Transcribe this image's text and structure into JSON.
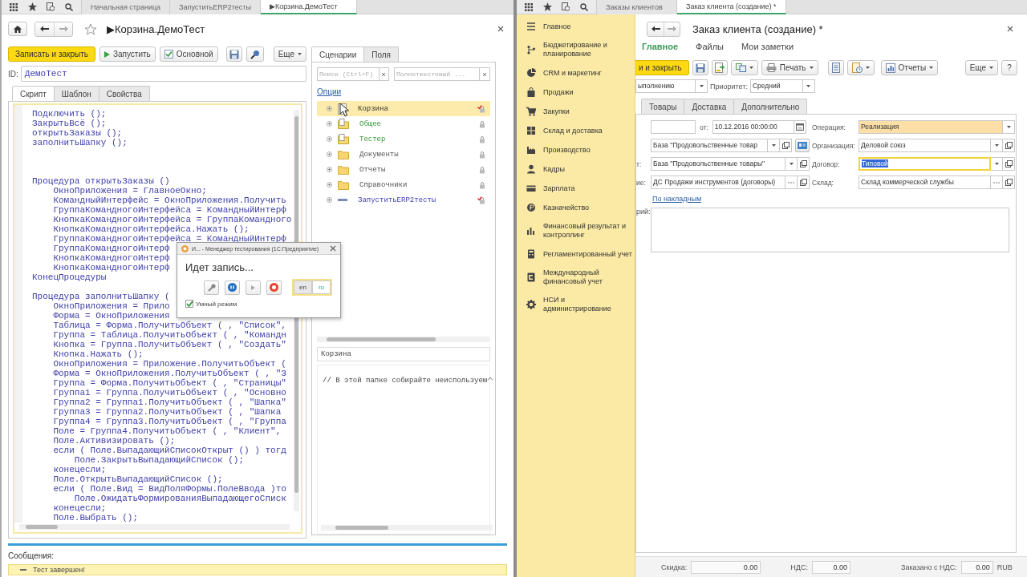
{
  "left_window": {
    "topbar": {
      "tabs": [
        {
          "label": "Начальная страница",
          "selected": false
        },
        {
          "label": "ЗапуститьERP2тесты",
          "selected": false
        },
        {
          "label": "▶Корзина.ДемоТест",
          "selected": true
        }
      ]
    },
    "title": "▶Корзина.ДемоТест",
    "toolbar": [
      {
        "kind": "primary",
        "label": "Записать и закрыть",
        "dropdown": false
      },
      {
        "kind": "run",
        "label": "Запустить",
        "dropdown": false
      },
      {
        "kind": "check",
        "label": "Основной",
        "dropdown": false
      },
      {
        "kind": "save",
        "dropdown": false
      },
      {
        "kind": "search",
        "dropdown": false
      }
    ],
    "toolbar_right": [
      {
        "kind": "more",
        "label": "Еще",
        "dropdown": true
      }
    ],
    "id_label": "ID:",
    "id_value": "ДемоТест",
    "editor_tabs": [
      {
        "label": "Скрипт",
        "selected": true
      },
      {
        "label": "Шаблон",
        "selected": false
      },
      {
        "label": "Свойства",
        "selected": false
      }
    ],
    "code": [
      {
        "kind": "code",
        "text": "Подключить ();"
      },
      {
        "kind": "code",
        "text": "ЗакрытьВсё ();"
      },
      {
        "kind": "code",
        "text": "открытьЗаказы ();"
      },
      {
        "kind": "code",
        "text": "заполнитьШапку ();"
      },
      {
        "kind": "blank"
      },
      {
        "kind": "blank"
      },
      {
        "kind": "blank"
      },
      {
        "kind": "code",
        "text": "Процедура открытьЗаказы ()"
      },
      {
        "kind": "code",
        "text": "    ОкноПриложения = ГлавноеОкно;"
      },
      {
        "kind": "code",
        "text": "    КомандныйИнтерфейс = ОкноПриложения.Получить"
      },
      {
        "kind": "code",
        "text": "    ГруппаКомандногоИнтерфейса = КомандныйИнтерф"
      },
      {
        "kind": "code",
        "text": "    КнопкаКомандногоИнтерфейса = ГруппаКомандного"
      },
      {
        "kind": "code",
        "text": "    КнопкаКомандногоИнтерфейса.Нажать ();"
      },
      {
        "kind": "code",
        "text": "    ГруппаКомандногоИнтерфейса = КомандныйИнтерф"
      },
      {
        "kind": "code",
        "text": "    ГруппаКомандногоИнтерф"
      },
      {
        "kind": "code",
        "text": "    КнопкаКомандногоИнтерф"
      },
      {
        "kind": "code",
        "text": "    КнопкаКомандногоИнтерф"
      },
      {
        "kind": "code",
        "text": "КонецПроцедуры"
      },
      {
        "kind": "blank"
      },
      {
        "kind": "code",
        "text": "Процедура заполнитьШапку ("
      },
      {
        "kind": "code",
        "text": "    ОкноПриложения = Прило"
      },
      {
        "kind": "code",
        "text": "    Форма = ОкноПриложения"
      },
      {
        "kind": "code",
        "text": "    Таблица = Форма.ПолучитьОбъект ( , \"Список\","
      },
      {
        "kind": "code",
        "text": "    Группа = Таблица.ПолучитьОбъект ( , \"Командн"
      },
      {
        "kind": "code",
        "text": "    Кнопка = Группа.ПолучитьОбъект ( , \"Создать\""
      },
      {
        "kind": "code",
        "text": "    Кнопка.Нажать ();"
      },
      {
        "kind": "code",
        "text": "    ОкноПриложения = Приложение.ПолучитьОбъект ("
      },
      {
        "kind": "code",
        "text": "    Форма = ОкноПриложения.ПолучитьОбъект ( , \"З"
      },
      {
        "kind": "code",
        "text": "    Группа = Форма.ПолучитьОбъект ( , \"Страницы\""
      },
      {
        "kind": "code",
        "text": "    Группа1 = Группа.ПолучитьОбъект ( , \"Основно"
      },
      {
        "kind": "code",
        "text": "    Группа2 = Группа1.ПолучитьОбъект ( , \"Шапка\""
      },
      {
        "kind": "code",
        "text": "    Группа3 = Группа2.ПолучитьОбъект ( , \"Шапка"
      },
      {
        "kind": "code",
        "text": "    Группа4 = Группа3.ПолучитьОбъект ( , \"Группа"
      },
      {
        "kind": "code",
        "text": "    Поле = Группа4.ПолучитьОбъект ( , \"Клиент\","
      },
      {
        "kind": "code",
        "text": "    Поле.Активизировать ();"
      },
      {
        "kind": "code",
        "text": "    если ( Поле.ВыпадающийСписокОткрыт () ) тогд"
      },
      {
        "kind": "code",
        "text": "        Поле.ЗакрытьВыпадающийСписок ();"
      },
      {
        "kind": "code",
        "text": "    конецесли;"
      },
      {
        "kind": "code",
        "text": "    Поле.ОткрытьВыпадающийСписок ();"
      },
      {
        "kind": "code",
        "text": "    если ( Поле.Вид = ВидПоляФормы.ПолеВвода )то"
      },
      {
        "kind": "code",
        "text": "        Поле.ОжидатьФормированияВыпадающегоСписк"
      },
      {
        "kind": "code",
        "text": "    конецесли;"
      },
      {
        "kind": "code",
        "text": "    Поле.Выбрать ();"
      }
    ],
    "side_tabs": [
      {
        "label": "Сценарии",
        "selected": true
      },
      {
        "label": "Поля",
        "selected": false
      }
    ],
    "search_placeholder": "Поиск (Ctrl+F)",
    "fulltext_placeholder": "Полнотекстовый ...",
    "options_link": "Опции",
    "tree": [
      {
        "label": "Корзина",
        "kind": "module",
        "selected": true,
        "changed": true
      },
      {
        "label": "Общее",
        "kind": "folder_doc",
        "selected": false,
        "changed": false
      },
      {
        "label": "Тестер",
        "kind": "folder_doc",
        "selected": false,
        "changed": false
      },
      {
        "label": "Документы",
        "kind": "folder",
        "selected": false,
        "changed": false
      },
      {
        "label": "Отчеты",
        "kind": "folder",
        "selected": false,
        "changed": false
      },
      {
        "label": "Справочники",
        "kind": "folder",
        "selected": false,
        "changed": false
      },
      {
        "label": "ЗапуститьERP2тесты",
        "kind": "link",
        "selected": false,
        "changed": true
      }
    ],
    "name_value": "Корзина",
    "description": "// В этой папке собирайте неиспользуем",
    "messages_title": "Сообщения:",
    "messages": [
      "Тест завершен!"
    ]
  },
  "recorder": {
    "title": "И... - Менеджер тестирования (1С:Предприятие)",
    "status": "Идет запись...",
    "languages": [
      {
        "label": "en",
        "selected": true
      },
      {
        "label": "ru",
        "selected": false
      }
    ],
    "smart_mode": {
      "label": "Умный режим",
      "checked": true
    }
  },
  "right_window": {
    "topbar": {
      "tabs": [
        {
          "label": "Заказы клиентов",
          "selected": false
        },
        {
          "label": "Заказ клиента (создание) *",
          "selected": true
        }
      ]
    },
    "sections": [
      "Главное",
      "Бюджетирование и\nпланирование",
      "CRM и маркетинг",
      "Продажи",
      "Закупки",
      "Склад и доставка",
      "Производство",
      "Кадры",
      "Зарплата",
      "Казначейство",
      "Финансовый результат и\nконтроллинг",
      "Регламентированный учет",
      "Международный\nфинансовый учет",
      "НСИ и\nадминистрирование"
    ],
    "title": "Заказ клиента (создание) *",
    "nav": [
      {
        "label": "Главное",
        "selected": true
      },
      {
        "label": "Файлы",
        "selected": false
      },
      {
        "label": "Мои заметки",
        "selected": false
      }
    ],
    "toolbar": [
      {
        "kind": "primary",
        "label": "и и закрыть",
        "dropdown": false
      },
      {
        "kind": "save",
        "dropdown": false
      },
      {
        "kind": "post",
        "dropdown": false
      },
      {
        "kind": "create",
        "dropdown": true
      },
      {
        "kind": "print",
        "label": "Печать",
        "dropdown": true
      },
      {
        "kind": "list",
        "dropdown": false
      },
      {
        "kind": "structure",
        "dropdown": true
      },
      {
        "kind": "reports",
        "label": "Отчеты",
        "dropdown": true
      }
    ],
    "toolbar_right": [
      {
        "kind": "more",
        "label": "Еще",
        "dropdown": true
      },
      {
        "kind": "help",
        "label": "?",
        "dropdown": false
      }
    ],
    "status_field": {
      "kind": "select",
      "value": "ыполнению"
    },
    "priority": {
      "kind": "select",
      "label": "Приоритет:",
      "value": "Средний"
    },
    "tabs": [
      {
        "label": "Товары",
        "selected": false
      },
      {
        "label": "Доставка",
        "selected": false
      },
      {
        "label": "Дополнительно",
        "selected": false
      }
    ],
    "date": {
      "label": "от:",
      "value": "10.12.2016 00:00:00"
    },
    "left_fields": [
      {
        "kind": "select_open_extra",
        "value": "База \"Продовольственные товар"
      },
      {
        "kind": "select_open",
        "label": "т:",
        "value": "База \"Продовольственные товары\""
      },
      {
        "kind": "choice_open",
        "label": "ие:",
        "value": "ДС Продажи инструментов (договоры)"
      }
    ],
    "right_fields": [
      {
        "kind": "select",
        "label": "Операция:",
        "value": "Реализация",
        "highlighted": true,
        "focused": false
      },
      {
        "kind": "select_open",
        "label": "Организация:",
        "value": "Деловой союз",
        "highlighted": false,
        "focused": false
      },
      {
        "kind": "select_open",
        "label": "Договор:",
        "value": "Типовой",
        "highlighted": false,
        "focused": true
      },
      {
        "kind": "choice_open",
        "label": "Склад:",
        "value": "Склад коммерческой службы",
        "highlighted": false,
        "focused": false
      }
    ],
    "invoice_link": "По накладным",
    "comment_label": "рий:",
    "totals": [
      {
        "label": "Скидка:",
        "value": "0.00"
      },
      {
        "label": "НДС:",
        "value": "0.00"
      },
      {
        "label": "Заказано с НДС:",
        "value": "0.00"
      }
    ],
    "currency": "RUB"
  }
}
